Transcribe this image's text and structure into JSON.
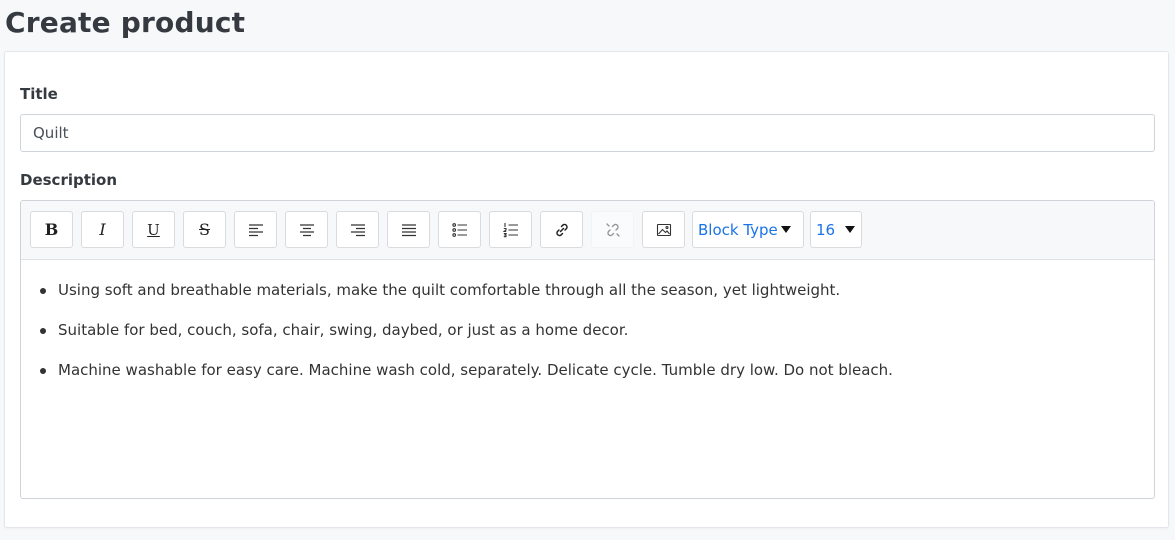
{
  "page": {
    "title": "Create product"
  },
  "form": {
    "title_label": "Title",
    "title_value": "Quilt",
    "description_label": "Description"
  },
  "toolbar": {
    "buttons": [
      {
        "name": "bold-button",
        "icon": "bold-icon",
        "glyph": "B"
      },
      {
        "name": "italic-button",
        "icon": "italic-icon",
        "glyph": "I"
      },
      {
        "name": "underline-button",
        "icon": "underline-icon",
        "glyph": "U"
      },
      {
        "name": "strikethrough-button",
        "icon": "strikethrough-icon",
        "glyph": "S"
      },
      {
        "name": "align-left-button",
        "icon": "align-left-icon"
      },
      {
        "name": "align-center-button",
        "icon": "align-center-icon"
      },
      {
        "name": "align-right-button",
        "icon": "align-right-icon"
      },
      {
        "name": "align-justify-button",
        "icon": "align-justify-icon"
      },
      {
        "name": "unordered-list-button",
        "icon": "bullet-list-icon"
      },
      {
        "name": "ordered-list-button",
        "icon": "numbered-list-icon"
      },
      {
        "name": "link-button",
        "icon": "link-icon"
      },
      {
        "name": "unlink-button",
        "icon": "unlink-icon",
        "disabled": true
      },
      {
        "name": "image-button",
        "icon": "image-icon"
      }
    ],
    "block_type": "Block Type",
    "font_size": "16",
    "accent_color": "#1a73e8"
  },
  "content": {
    "bullets": [
      "Using soft and breathable materials, make the quilt comfortable through all the season, yet lightweight.",
      "Suitable for bed, couch, sofa, chair, swing, daybed, or just as a home decor.",
      "Machine washable for easy care. Machine wash cold, separately. Delicate cycle. Tumble dry low. Do not bleach."
    ]
  }
}
